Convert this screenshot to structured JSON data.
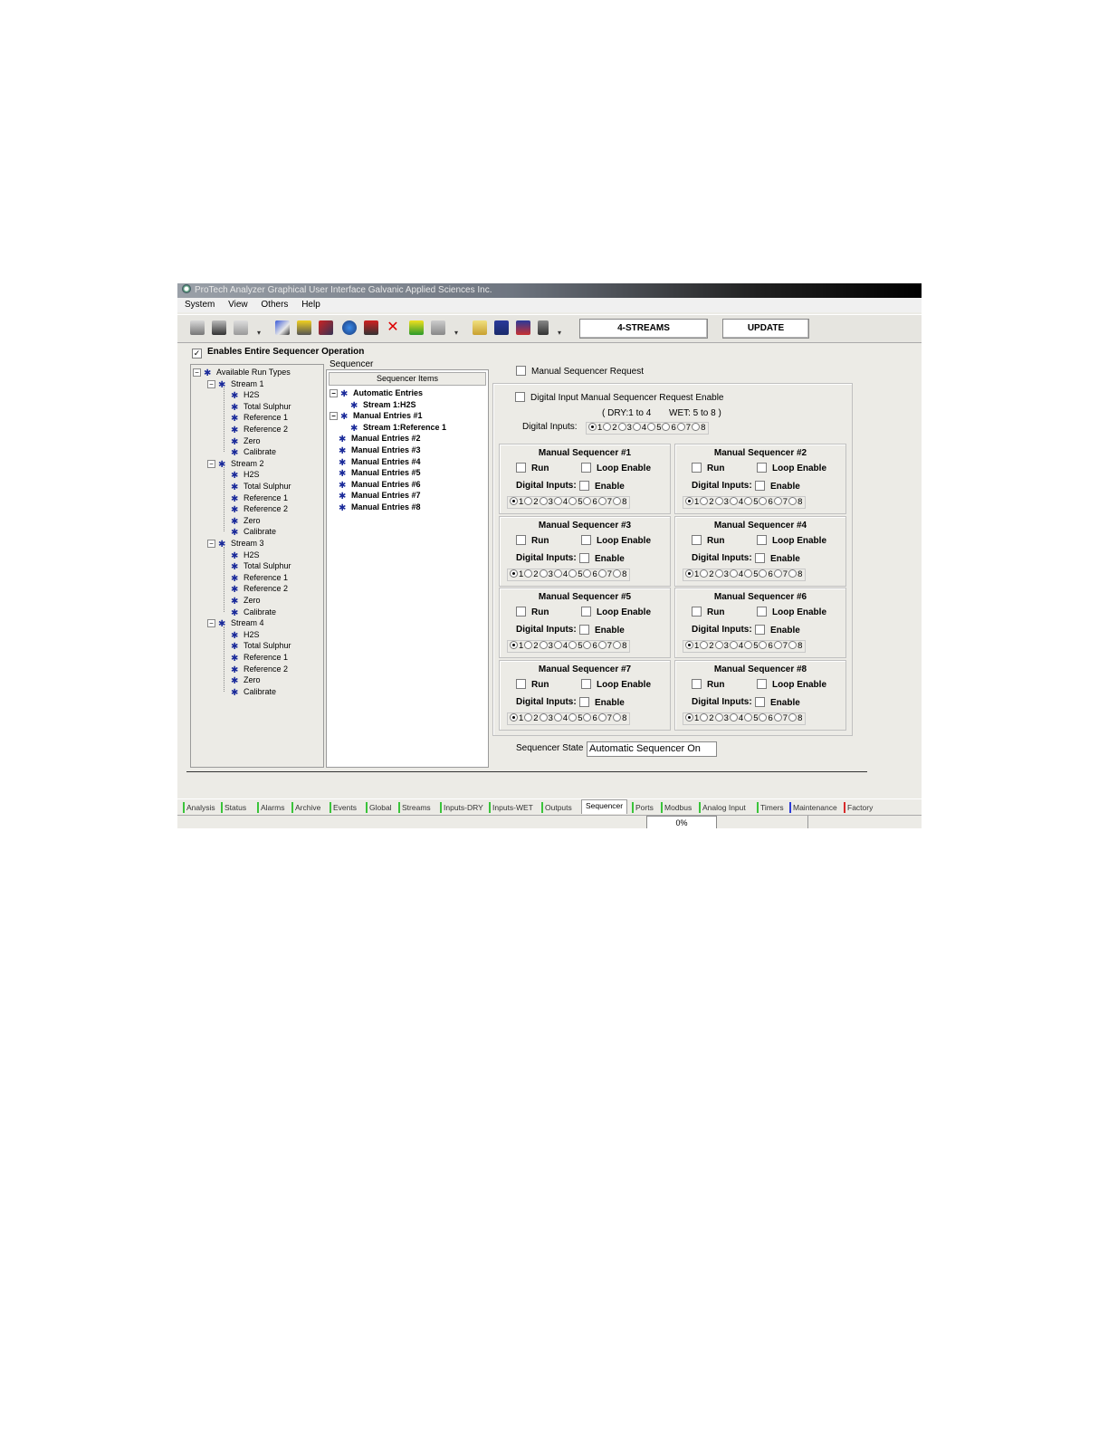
{
  "window": {
    "title": "ProTech Analyzer Graphical User Interface   Galvanic Applied Sciences Inc."
  },
  "menu": [
    "System",
    "View",
    "Others",
    "Help"
  ],
  "toolbar": {
    "streams_button": "4-STREAMS",
    "update_button": "UPDATE"
  },
  "enable_all": {
    "label": "Enables Entire Sequencer Operation",
    "checked": true
  },
  "run_types": {
    "root": "Available Run Types",
    "streams": [
      {
        "name": "Stream 1",
        "items": [
          "H2S",
          "Total Sulphur",
          "Reference 1",
          "Reference 2",
          "Zero",
          "Calibrate"
        ]
      },
      {
        "name": "Stream 2",
        "items": [
          "H2S",
          "Total Sulphur",
          "Reference 1",
          "Reference 2",
          "Zero",
          "Calibrate"
        ]
      },
      {
        "name": "Stream 3",
        "items": [
          "H2S",
          "Total Sulphur",
          "Reference 1",
          "Reference 2",
          "Zero",
          "Calibrate"
        ]
      },
      {
        "name": "Stream 4",
        "items": [
          "H2S",
          "Total Sulphur",
          "Reference 1",
          "Reference 2",
          "Zero",
          "Calibrate"
        ]
      }
    ]
  },
  "sequencer": {
    "group_label": "Sequencer",
    "column_header": "Sequencer Items",
    "automatic": {
      "label": "Automatic Entries",
      "children": [
        "Stream 1:H2S"
      ]
    },
    "manual1": {
      "label": "Manual Entries #1",
      "children": [
        "Stream 1:Reference 1"
      ]
    },
    "others": [
      "Manual Entries #2",
      "Manual Entries #3",
      "Manual Entries #4",
      "Manual Entries #5",
      "Manual Entries #6",
      "Manual Entries #7",
      "Manual Entries #8"
    ]
  },
  "manual_request": {
    "label": "Manual Sequencer Request",
    "di_enable_label": "Digital Input Manual Sequencer Request Enable",
    "range_dry": "( DRY:1 to 4",
    "range_wet": "WET: 5 to 8 )",
    "digital_inputs_label": "Digital Inputs:",
    "selected": 1
  },
  "manual_sequencers": [
    {
      "title": "Manual Sequencer #1",
      "run": "Run",
      "loop": "Loop Enable",
      "di": "Digital Inputs:",
      "enable": "Enable",
      "selected": 1
    },
    {
      "title": "Manual Sequencer #2",
      "run": "Run",
      "loop": "Loop Enable",
      "di": "Digital Inputs:",
      "enable": "Enable",
      "selected": 1
    },
    {
      "title": "Manual Sequencer #3",
      "run": "Run",
      "loop": "Loop Enable",
      "di": "Digital Inputs:",
      "enable": "Enable",
      "selected": 1
    },
    {
      "title": "Manual Sequencer #4",
      "run": "Run",
      "loop": "Loop Enable",
      "di": "Digital Inputs:",
      "enable": "Enable",
      "selected": 1
    },
    {
      "title": "Manual Sequencer #5",
      "run": "Run",
      "loop": "Loop Enable",
      "di": "Digital Inputs:",
      "enable": "Enable",
      "selected": 1
    },
    {
      "title": "Manual Sequencer #6",
      "run": "Run",
      "loop": "Loop Enable",
      "di": "Digital Inputs:",
      "enable": "Enable",
      "selected": 1
    },
    {
      "title": "Manual Sequencer #7",
      "run": "Run",
      "loop": "Loop Enable",
      "di": "Digital Inputs:",
      "enable": "Enable",
      "selected": 1
    },
    {
      "title": "Manual Sequencer #8",
      "run": "Run",
      "loop": "Loop Enable",
      "di": "Digital Inputs:",
      "enable": "Enable",
      "selected": 1
    }
  ],
  "radio_options": [
    "1",
    "2",
    "3",
    "4",
    "5",
    "6",
    "7",
    "8"
  ],
  "sequencer_state": {
    "label": "Sequencer State",
    "value": "Automatic Sequencer On"
  },
  "tabs": [
    "Analysis",
    "Status",
    "Alarms",
    "Archive",
    "Events",
    "Global",
    "Streams",
    "Inputs-DRY",
    "Inputs-WET",
    "Outputs",
    "Sequencer",
    "Ports",
    "Modbus",
    "Analog Input",
    "Timers",
    "Maintenance",
    "Factory"
  ],
  "active_tab": "Sequencer",
  "tab_marker_colors": {
    "default": "#3ac43a",
    "Maintenance": "#2a3ad8",
    "Factory": "#d82a2a"
  },
  "status": {
    "progress_text": "0%"
  }
}
